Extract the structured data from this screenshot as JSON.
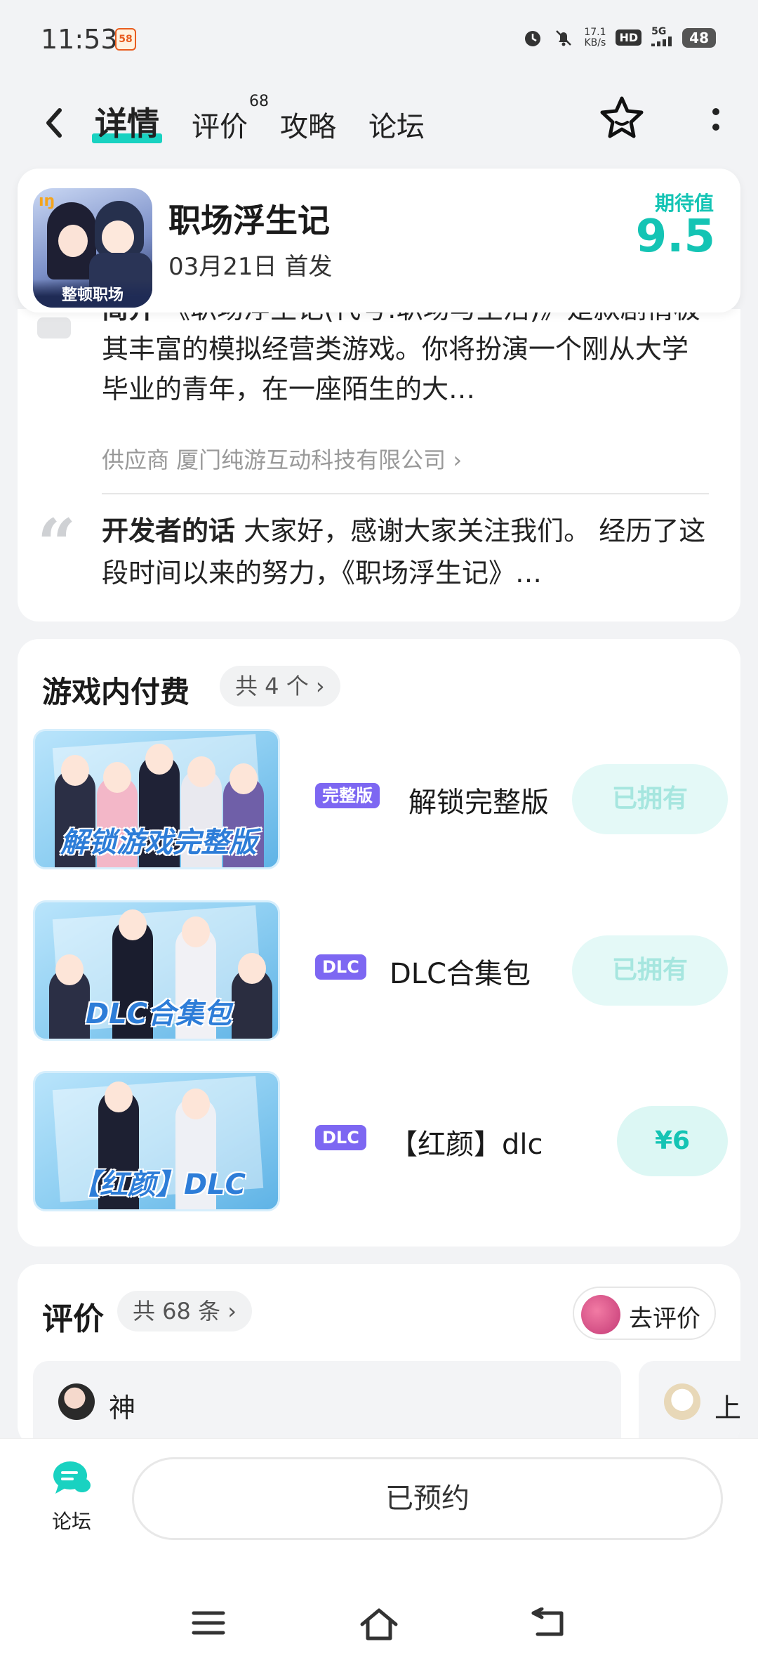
{
  "status_bar": {
    "time": "11:53",
    "app_badge": "58",
    "speed_value": "17.1",
    "speed_unit": "KB/s",
    "hd": "HD",
    "network": "5G",
    "battery": "48"
  },
  "nav": {
    "tabs": [
      {
        "label": "详情",
        "active": true
      },
      {
        "label": "评价",
        "badge": "68"
      },
      {
        "label": "攻略"
      },
      {
        "label": "论坛"
      }
    ]
  },
  "game": {
    "title": "职场浮生记",
    "release": "03月21日 首发",
    "expect_label": "期待值",
    "expect_score": "9.5",
    "icon_text": "整顿职场"
  },
  "intro": {
    "lead": "简介",
    "text": "《职场浮生记(代号:职场与生活)》是款剧情极其丰富的模拟经营类游戏。你将扮演一个刚从大学毕业的青年，在一座陌生的大…",
    "supplier": "供应商 厦门纯游互动科技有限公司 ›",
    "dev_lead": "开发者的话",
    "dev_text": "大家好，感谢大家关注我们。 经历了这段时间以来的努力，《职场浮生记》…"
  },
  "iap": {
    "title": "游戏内付费",
    "count": "共 4 个 ›",
    "items": [
      {
        "tag": "完整版",
        "name": "解锁完整版",
        "price": "已拥有",
        "owned": true,
        "thumb_caption": "解锁游戏完整版"
      },
      {
        "tag": "DLC",
        "name": "DLC合集包",
        "price": "已拥有",
        "owned": true,
        "thumb_caption": "DLC合集包"
      },
      {
        "tag": "DLC",
        "name": "【红颜】dlc",
        "price": "¥6",
        "owned": false,
        "thumb_caption": "【红颜】DLC"
      }
    ]
  },
  "reviews": {
    "title": "评价",
    "count": "共 68 条 ›",
    "go_review": "去评价",
    "items": [
      {
        "user": "神"
      },
      {
        "user": "上"
      }
    ]
  },
  "bottom": {
    "forum": "论坛",
    "reserved": "已预约"
  },
  "colors": {
    "accent": "#19d2c1",
    "tag": "#7d67f2"
  }
}
